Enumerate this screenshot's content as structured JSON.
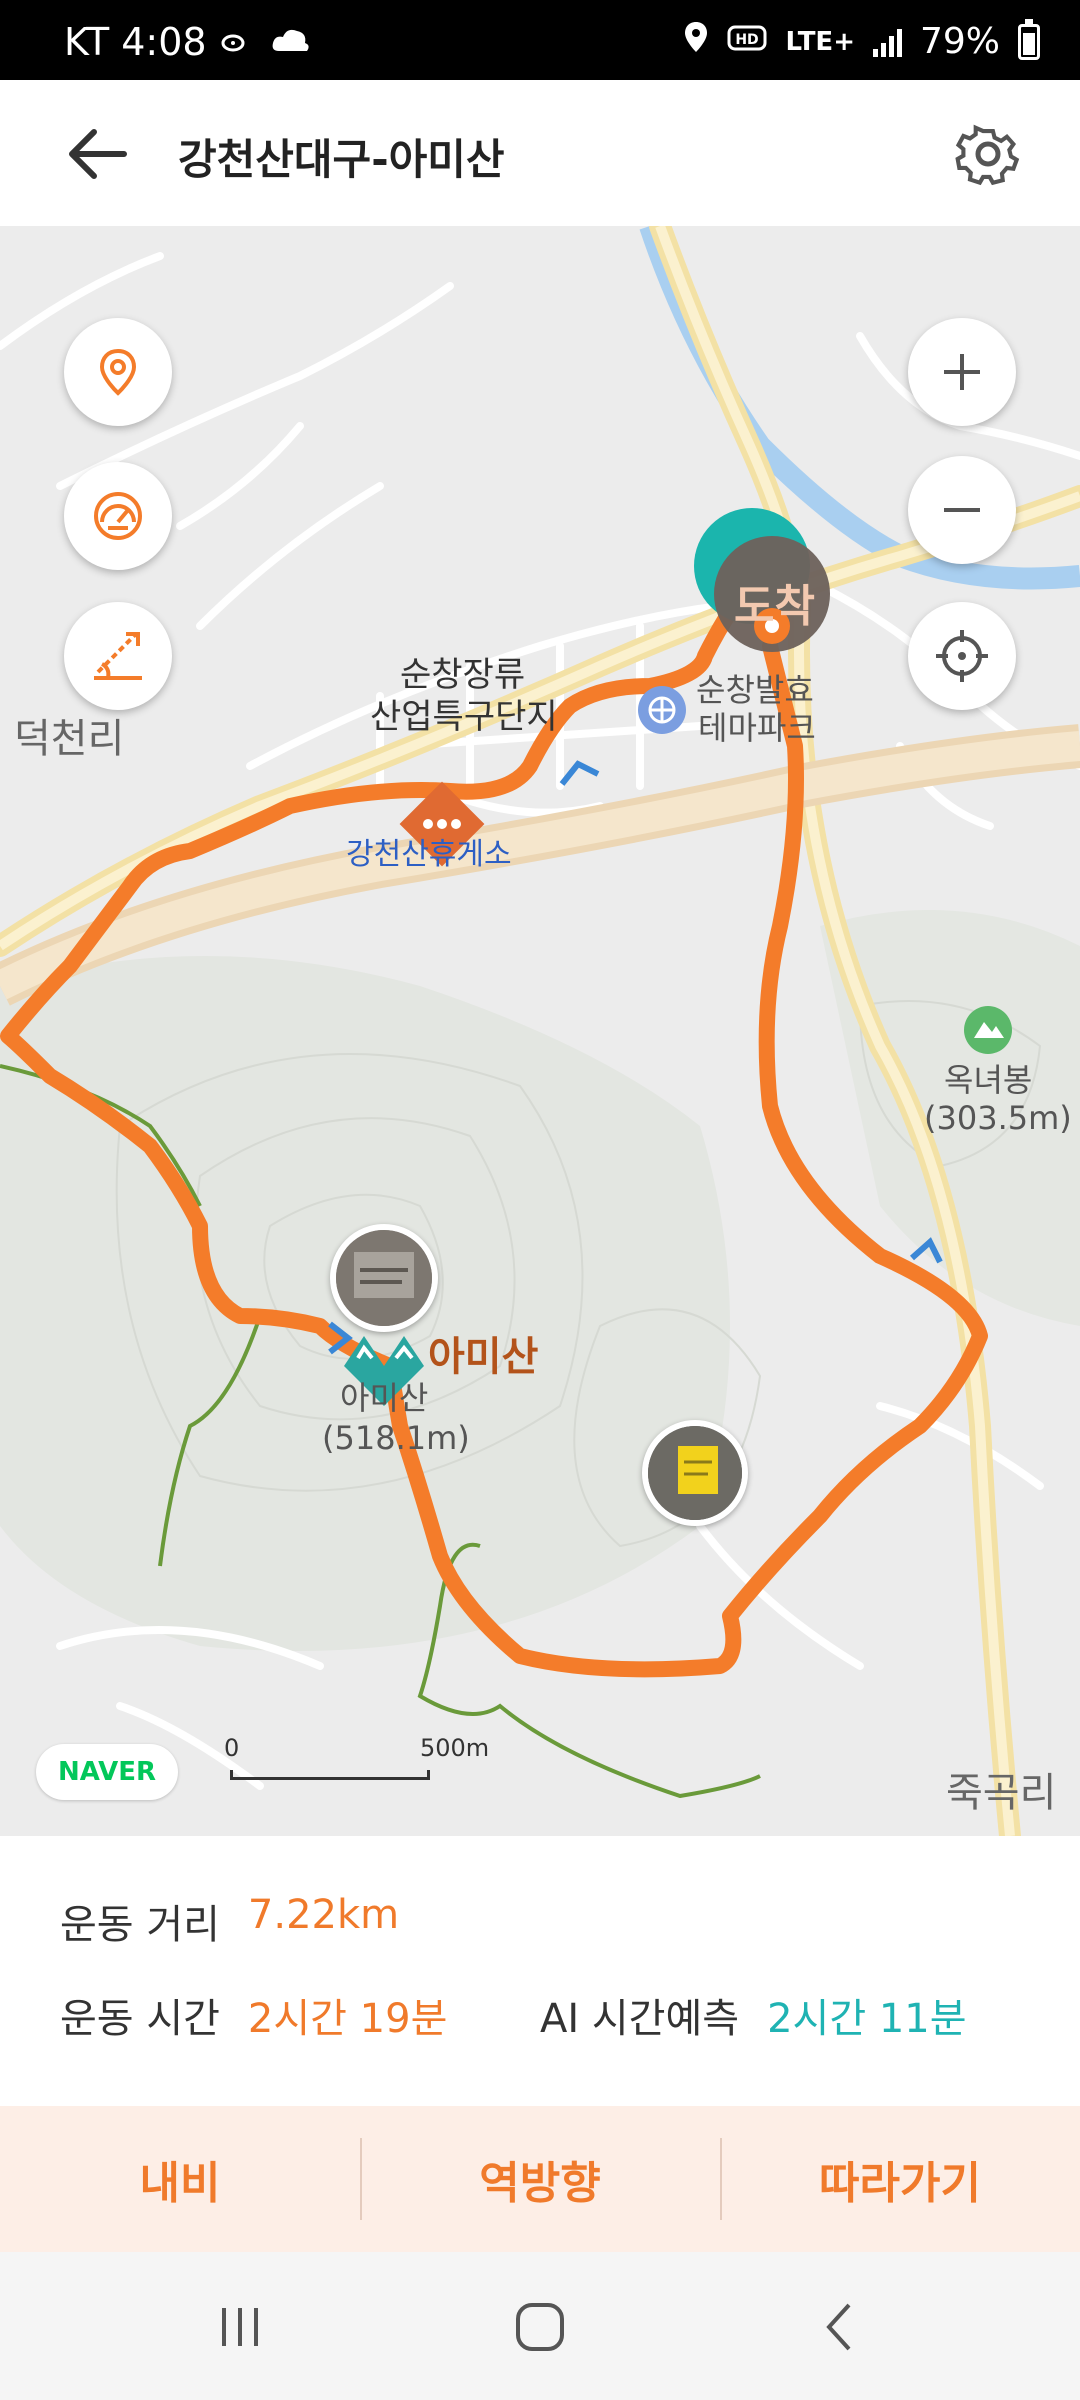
{
  "status_bar": {
    "carrier_time": "KT 4:08",
    "network": "LTE+",
    "battery": "79%"
  },
  "header": {
    "title": "강천산대구-아미산",
    "icons": [
      "back-arrow-icon",
      "gear-icon"
    ]
  },
  "map": {
    "labels": {
      "region_left": "덕천리",
      "region_bottom_right": "죽곡리",
      "industrial_l1": "순창장류",
      "industrial_l2": "산업특구단지",
      "theme_park_l1": "순창발효",
      "theme_park_l2": "테마파크",
      "rest_area": "강천산휴게소",
      "peak_amisan_l1": "아미산",
      "peak_amisan_l2": "(518.1m)",
      "peak_amisan_name": "아미산",
      "peak_oknyeo_l1": "옥녀봉",
      "peak_oknyeo_l2": "(303.5m)",
      "arrival": "도착"
    },
    "naver": "NAVER",
    "scale_start": "0",
    "scale_end": "500m",
    "route_color": "#f47c2a",
    "trail_color": "#6a9a3a"
  },
  "info": {
    "distance_label": "운동 거리",
    "distance_value": "7.22km",
    "time_label": "운동 시간",
    "time_value": "2시간 19분",
    "ai_label": "AI 시간예측",
    "ai_value": "2시간 11분"
  },
  "actions": {
    "navi": "내비",
    "reverse": "역방향",
    "follow": "따라가기"
  }
}
